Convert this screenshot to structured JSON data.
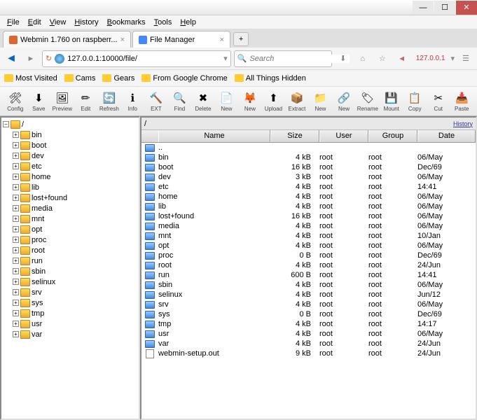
{
  "menubar": [
    "File",
    "Edit",
    "View",
    "History",
    "Bookmarks",
    "Tools",
    "Help"
  ],
  "tabs": [
    {
      "label": "Webmin 1.760 on raspberr...",
      "active": false
    },
    {
      "label": "File Manager",
      "active": true
    }
  ],
  "url": "127.0.0.1:10000/file/",
  "search_placeholder": "Search",
  "ip_indicator": "127.0.0.1",
  "bookmarks": [
    "Most Visited",
    "Cams",
    "Gears",
    "From Google Chrome",
    "All Things Hidden"
  ],
  "toolbar": [
    {
      "icon": "🛠",
      "label": "Config"
    },
    {
      "icon": "⬇",
      "label": "Save"
    },
    {
      "icon": "🖼",
      "label": "Preview"
    },
    {
      "icon": "✏",
      "label": "Edit"
    },
    {
      "icon": "🔄",
      "label": "Refresh"
    },
    {
      "icon": "ℹ",
      "label": "Info"
    },
    {
      "icon": "🔨",
      "label": "EXT"
    },
    {
      "icon": "🔍",
      "label": "Find"
    },
    {
      "icon": "✖",
      "label": "Delete"
    },
    {
      "icon": "📄",
      "label": "New"
    },
    {
      "icon": "🦊",
      "label": "New"
    },
    {
      "icon": "⬆",
      "label": "Upload"
    },
    {
      "icon": "📦",
      "label": "Extract"
    },
    {
      "icon": "📁",
      "label": "New"
    },
    {
      "icon": "🔗",
      "label": "New"
    },
    {
      "icon": "🏷",
      "label": "Rename"
    },
    {
      "icon": "💾",
      "label": "Mount"
    },
    {
      "icon": "📋",
      "label": "Copy"
    },
    {
      "icon": "✂",
      "label": "Cut"
    },
    {
      "icon": "📥",
      "label": "Paste"
    }
  ],
  "tree_root": "/",
  "tree": [
    "bin",
    "boot",
    "dev",
    "etc",
    "home",
    "lib",
    "lost+found",
    "media",
    "mnt",
    "opt",
    "proc",
    "root",
    "run",
    "sbin",
    "selinux",
    "srv",
    "sys",
    "tmp",
    "usr",
    "var"
  ],
  "current_path": "/",
  "history_label": "History",
  "columns": {
    "name": "Name",
    "size": "Size",
    "user": "User",
    "group": "Group",
    "date": "Date"
  },
  "files": [
    {
      "name": "..",
      "size": "",
      "user": "",
      "group": "",
      "date": "",
      "type": "up"
    },
    {
      "name": "bin",
      "size": "4 kB",
      "user": "root",
      "group": "root",
      "date": "06/May",
      "type": "dir"
    },
    {
      "name": "boot",
      "size": "16 kB",
      "user": "root",
      "group": "root",
      "date": "Dec/69",
      "type": "dir"
    },
    {
      "name": "dev",
      "size": "3 kB",
      "user": "root",
      "group": "root",
      "date": "06/May",
      "type": "dir"
    },
    {
      "name": "etc",
      "size": "4 kB",
      "user": "root",
      "group": "root",
      "date": "14:41",
      "type": "dir"
    },
    {
      "name": "home",
      "size": "4 kB",
      "user": "root",
      "group": "root",
      "date": "06/May",
      "type": "dir"
    },
    {
      "name": "lib",
      "size": "4 kB",
      "user": "root",
      "group": "root",
      "date": "06/May",
      "type": "dir"
    },
    {
      "name": "lost+found",
      "size": "16 kB",
      "user": "root",
      "group": "root",
      "date": "06/May",
      "type": "dir"
    },
    {
      "name": "media",
      "size": "4 kB",
      "user": "root",
      "group": "root",
      "date": "06/May",
      "type": "dir"
    },
    {
      "name": "mnt",
      "size": "4 kB",
      "user": "root",
      "group": "root",
      "date": "10/Jan",
      "type": "dir"
    },
    {
      "name": "opt",
      "size": "4 kB",
      "user": "root",
      "group": "root",
      "date": "06/May",
      "type": "dir"
    },
    {
      "name": "proc",
      "size": "0 B",
      "user": "root",
      "group": "root",
      "date": "Dec/69",
      "type": "dir"
    },
    {
      "name": "root",
      "size": "4 kB",
      "user": "root",
      "group": "root",
      "date": "24/Jun",
      "type": "dir"
    },
    {
      "name": "run",
      "size": "600 B",
      "user": "root",
      "group": "root",
      "date": "14:41",
      "type": "dir"
    },
    {
      "name": "sbin",
      "size": "4 kB",
      "user": "root",
      "group": "root",
      "date": "06/May",
      "type": "dir"
    },
    {
      "name": "selinux",
      "size": "4 kB",
      "user": "root",
      "group": "root",
      "date": "Jun/12",
      "type": "dir"
    },
    {
      "name": "srv",
      "size": "4 kB",
      "user": "root",
      "group": "root",
      "date": "06/May",
      "type": "dir"
    },
    {
      "name": "sys",
      "size": "0 B",
      "user": "root",
      "group": "root",
      "date": "Dec/69",
      "type": "dir"
    },
    {
      "name": "tmp",
      "size": "4 kB",
      "user": "root",
      "group": "root",
      "date": "14:17",
      "type": "dir"
    },
    {
      "name": "usr",
      "size": "4 kB",
      "user": "root",
      "group": "root",
      "date": "06/May",
      "type": "dir"
    },
    {
      "name": "var",
      "size": "4 kB",
      "user": "root",
      "group": "root",
      "date": "24/Jun",
      "type": "dir"
    },
    {
      "name": "webmin-setup.out",
      "size": "9 kB",
      "user": "root",
      "group": "root",
      "date": "24/Jun",
      "type": "file"
    }
  ]
}
